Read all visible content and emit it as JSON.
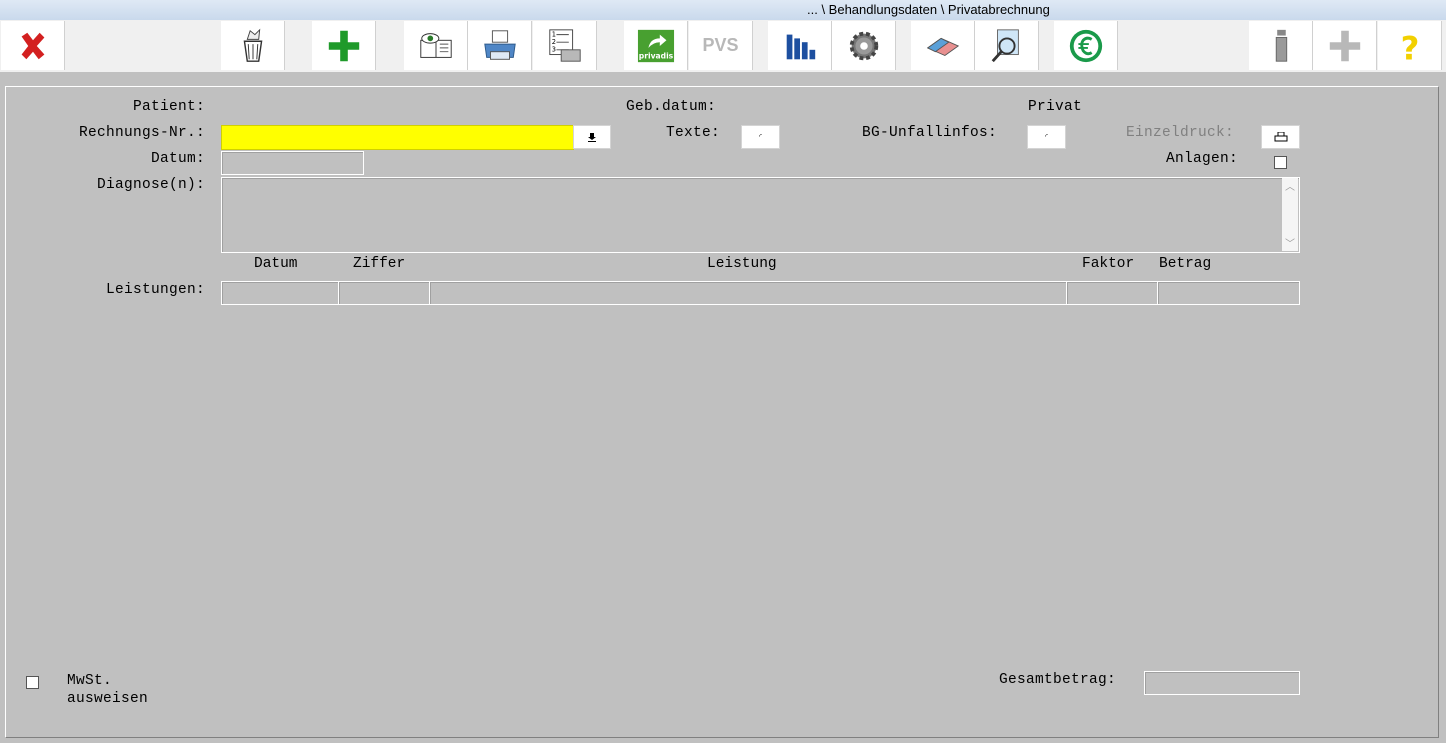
{
  "window": {
    "title": "... \\ Behandlungsdaten \\ Privatabrechnung"
  },
  "toolbar": {
    "buttons": [
      {
        "name": "close",
        "icon": "red-x-icon"
      },
      {
        "name": "delete",
        "icon": "trash-icon"
      },
      {
        "name": "add",
        "icon": "green-plus-icon"
      },
      {
        "name": "preview",
        "icon": "eye-document-icon"
      },
      {
        "name": "print",
        "icon": "printer-icon"
      },
      {
        "name": "print-list",
        "icon": "numbered-list-printer-icon"
      },
      {
        "name": "privadis",
        "icon": "privadis-logo",
        "label": "privadis"
      },
      {
        "name": "pvs",
        "icon": "pvs-logo",
        "label": "PVS"
      },
      {
        "name": "statistics",
        "icon": "bar-chart-icon"
      },
      {
        "name": "settings",
        "icon": "gear-icon"
      },
      {
        "name": "eraser",
        "icon": "eraser-icon"
      },
      {
        "name": "search",
        "icon": "magnifier-document-icon"
      },
      {
        "name": "euro",
        "icon": "euro-icon"
      },
      {
        "name": "info",
        "icon": "info-icon"
      },
      {
        "name": "add-disabled",
        "icon": "gray-plus-icon"
      },
      {
        "name": "help",
        "icon": "question-icon"
      }
    ]
  },
  "form": {
    "patient_label": "Patient:",
    "gebdatum_label": "Geb.datum:",
    "privat_label": "Privat",
    "rechnungs_label": "Rechnungs-Nr.:",
    "rechnungs_value": "",
    "texte_label": "Texte:",
    "bg_label": "BG-Unfallinfos:",
    "einzeldruck_label": "Einzeldruck:",
    "datum_label": "Datum:",
    "datum_value": "",
    "anlagen_label": "Anlagen:",
    "diagnose_label": "Diagnose(n):",
    "diagnose_value": "",
    "leistungen_label": "Leistungen:",
    "columns": [
      "Datum",
      "Ziffer",
      "Leistung",
      "Faktor",
      "Betrag"
    ],
    "mwst_label_1": "MwSt.",
    "mwst_label_2": "ausweisen",
    "gesamtbetrag_label": "Gesamtbetrag:",
    "gesamtbetrag_value": "",
    "accent_yellow": "#ffff00"
  }
}
